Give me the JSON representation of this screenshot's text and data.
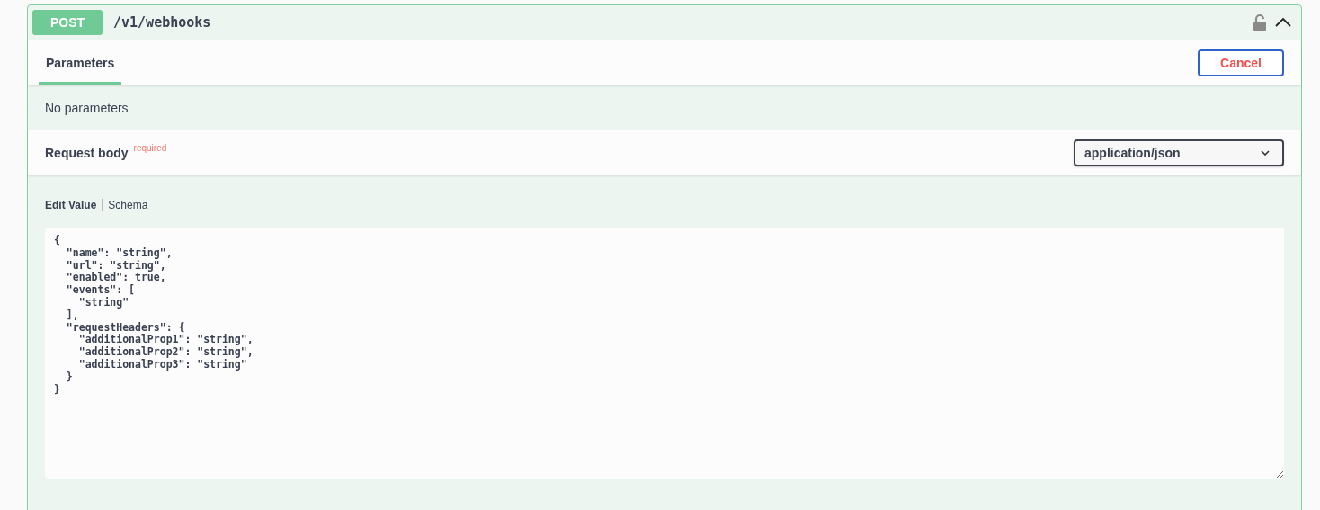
{
  "operation": {
    "method": "POST",
    "path": "/v1/webhooks",
    "locked": false,
    "expanded": true
  },
  "tabs": [
    {
      "label": "Parameters",
      "selected": true
    }
  ],
  "cancel_button": "Cancel",
  "parameters_message": "No parameters",
  "request_body": {
    "title": "Request body",
    "required_label": "required",
    "content_type": "application/json"
  },
  "body_tabs": [
    {
      "label": "Edit Value",
      "selected": true
    },
    {
      "label": "Schema",
      "selected": false
    }
  ],
  "body_value": "{\n  \"name\": \"string\",\n  \"url\": \"string\",\n  \"enabled\": true,\n  \"events\": [\n    \"string\"\n  ],\n  \"requestHeaders\": {\n    \"additionalProp1\": \"string\",\n    \"additionalProp2\": \"string\",\n    \"additionalProp3\": \"string\"\n  }\n}"
}
